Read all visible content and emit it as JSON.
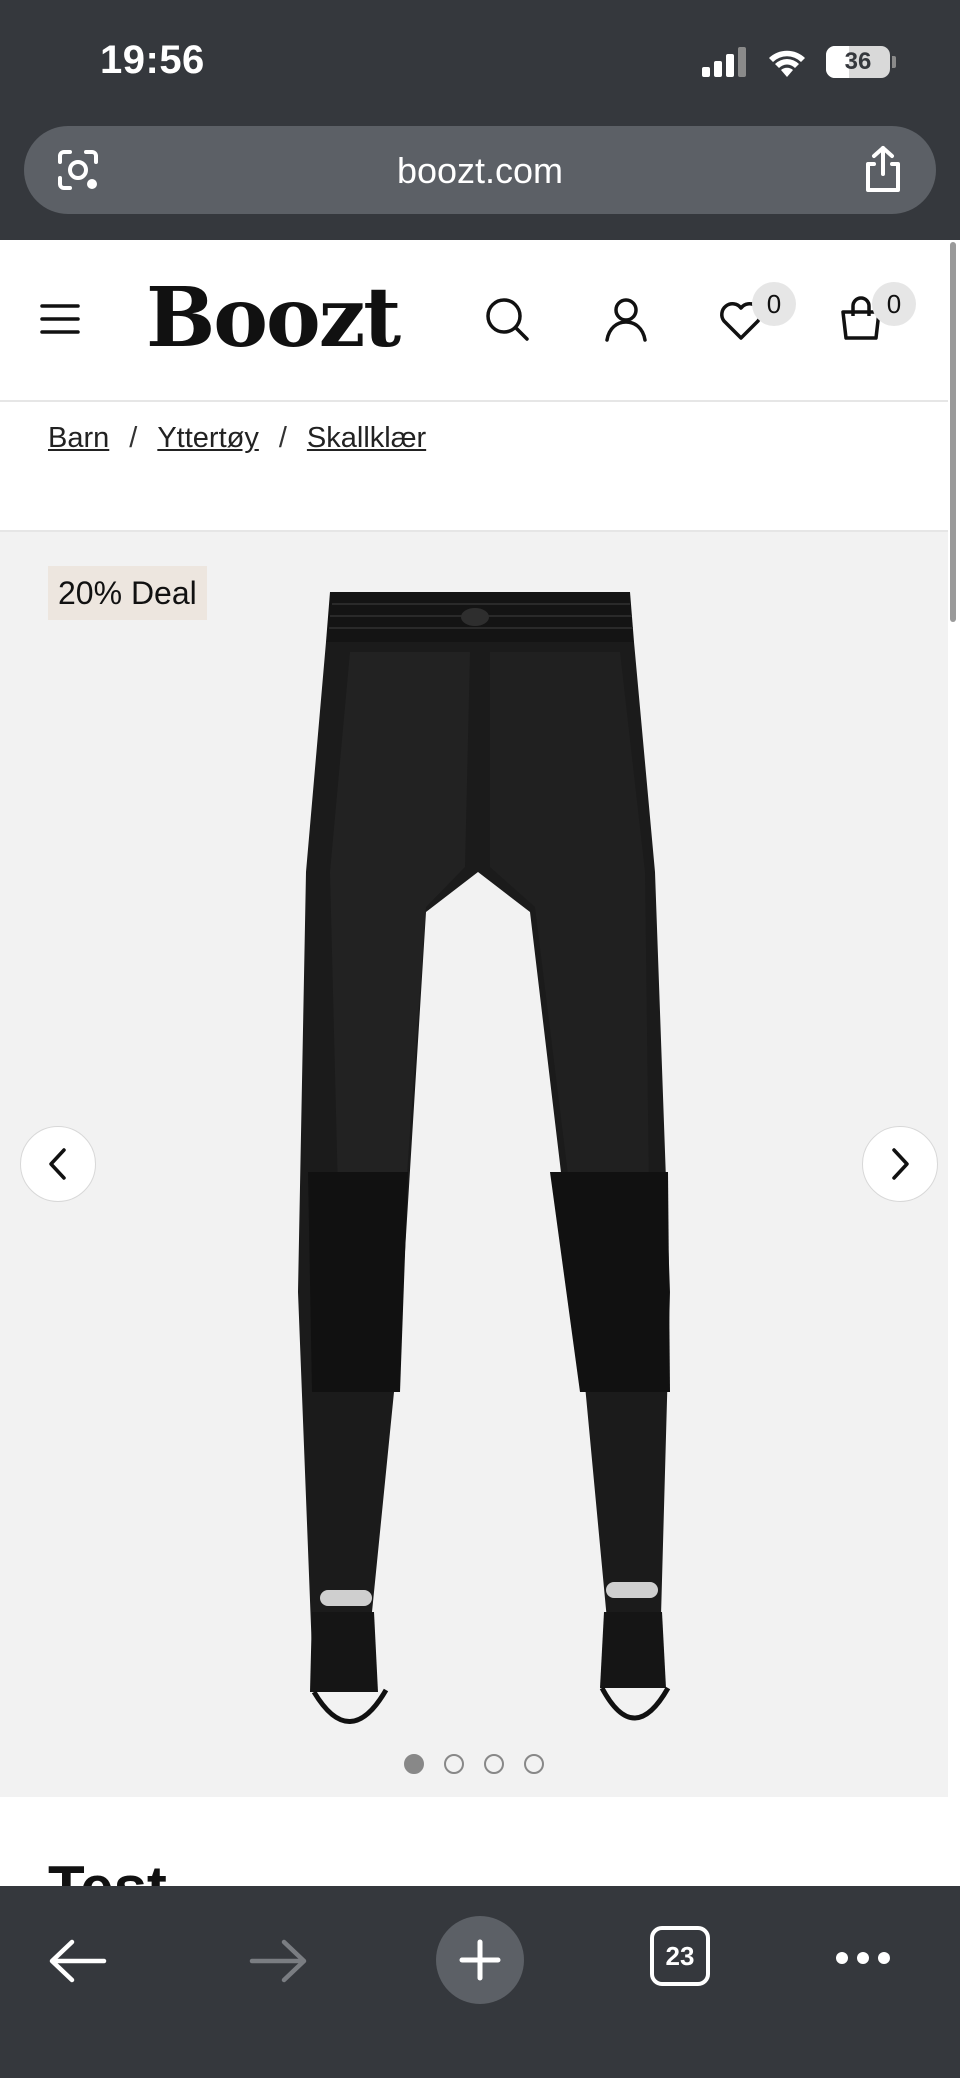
{
  "status_bar": {
    "time": "19:56",
    "battery_level": "36",
    "battery_fraction": 0.36
  },
  "address_bar": {
    "url": "boozt.com"
  },
  "header": {
    "logo": "Boozt",
    "wishlist_count": "0",
    "cart_count": "0",
    "icons": [
      "menu-icon",
      "search-icon",
      "account-icon",
      "heart-icon",
      "bag-icon"
    ]
  },
  "breadcrumb": {
    "items": [
      {
        "label": "Barn"
      },
      {
        "label": "Yttertøy"
      },
      {
        "label": "Skallklær"
      }
    ],
    "separator": "/"
  },
  "gallery": {
    "deal_badge": "20% Deal",
    "image_count": 4,
    "active_image": 1
  },
  "below_title": "Test",
  "toolbar": {
    "tabs_count": "23"
  },
  "colors": {
    "chrome": "#35383d",
    "address_pill": "#5c6066",
    "deal_badge_bg": "#ede6df",
    "gallery_bg": "#f2f2f2"
  }
}
